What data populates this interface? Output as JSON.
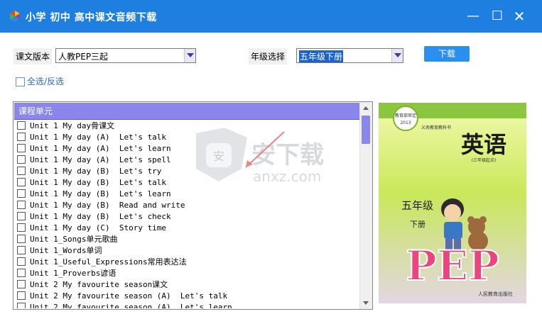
{
  "window": {
    "title": "小学 初中 高中课文音频下载",
    "minimize": "—",
    "maximize": "☐",
    "close": "✕"
  },
  "controls": {
    "edition_label": "课文版本",
    "edition_value": "人教PEP三起",
    "grade_label": "年级选择",
    "grade_value": "五年级下册",
    "download_label": "下载",
    "select_all_label": "全选/反选"
  },
  "list": {
    "header": "课程单元",
    "items": [
      "Unit 1 My day骨课文",
      "Unit 1 My day (A)  Let's talk",
      "Unit 1 My day (A)  Let's learn",
      "Unit 1 My day (A)  Let's spell",
      "Unit 1 My day (B)  Let's try",
      "Unit 1 My day (B)  Let's talk",
      "Unit 1 My day (B)  Let's learn",
      "Unit 1 My day (B)  Read and write",
      "Unit 1 My day (B)  Let's check",
      "Unit 1 My day (C)  Story time",
      "Unit 1_Songs单元歌曲",
      "Unit 1_Words单词",
      "Unit 1_Useful_Expressions常用表达法",
      "Unit 1_Proverbs谚语",
      "Unit 2 My favourite season课文",
      "Unit 2 My favourite season (A)  Let's talk",
      "Unit 2 My favourite season (A)  Let's learn"
    ]
  },
  "cover": {
    "title": "英语",
    "subtitle": "(三年级起点)",
    "grade": "五年级",
    "volume": "下册",
    "brand": "PEP",
    "badge_top": "义务教育教科书",
    "seal_text": "教育部审定",
    "seal_year": "2013",
    "publisher": "人民教育出版社"
  },
  "watermark": {
    "text": "安下载",
    "domain": "anxz.com"
  },
  "colors": {
    "titlebar": "#1e7fe0",
    "header": "#8a86ec",
    "button": "#2b8ff0"
  }
}
